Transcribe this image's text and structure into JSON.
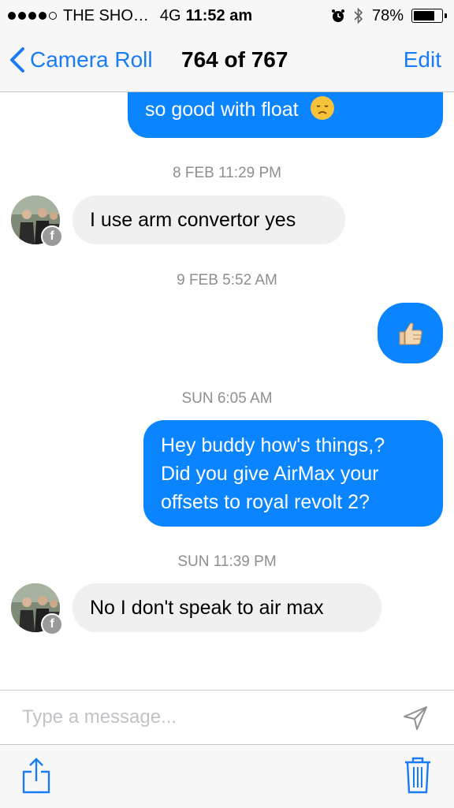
{
  "status_bar": {
    "carrier": "THE SHO…",
    "network": "4G",
    "time": "11:52 am",
    "battery": "78%",
    "battery_level": 0.78
  },
  "nav": {
    "back_label": "Camera Roll",
    "title": "764 of 767",
    "edit_label": "Edit"
  },
  "messages": [
    {
      "direction": "out",
      "text": "so good with float",
      "emoji": "disappointed-face"
    },
    {
      "timestamp": "8 FEB 11:29 PM"
    },
    {
      "direction": "in",
      "text": "I use arm convertor yes"
    },
    {
      "timestamp": "9 FEB 5:52 AM"
    },
    {
      "direction": "out",
      "emoji": "thumbs-up"
    },
    {
      "timestamp": "SUN 6:05 AM"
    },
    {
      "direction": "out",
      "lines": [
        "Hey buddy how's things,?",
        "Did you give AirMax your",
        "offsets to royal revolt 2?"
      ]
    },
    {
      "timestamp": "SUN 11:39 PM"
    },
    {
      "direction": "in",
      "text": "No I don't speak to air max"
    }
  ],
  "composer": {
    "placeholder": "Type a message..."
  },
  "toolbar": {
    "share_icon": "share-icon",
    "trash_icon": "trash-icon"
  },
  "colors": {
    "accent": "#1a7cf5",
    "outgoing_bubble": "#0a84ff",
    "incoming_bubble": "#f0f0f0",
    "timestamp": "#8e8e93"
  }
}
